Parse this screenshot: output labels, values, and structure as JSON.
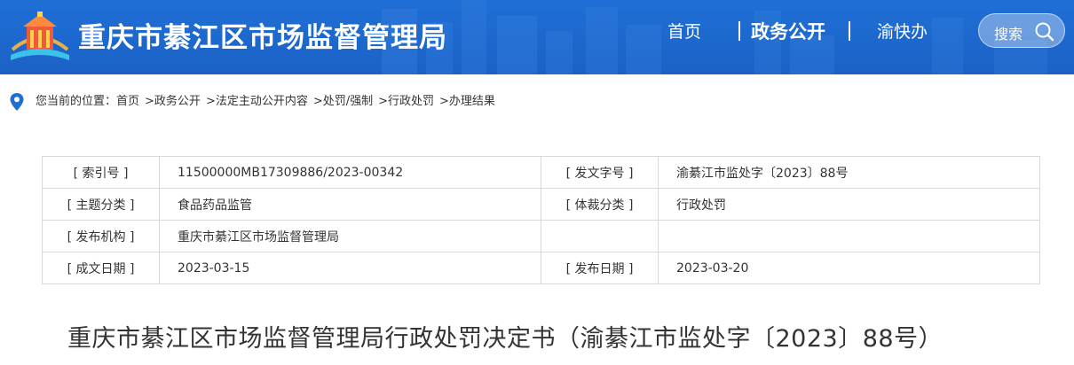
{
  "header": {
    "site_title": "重庆市綦江区市场监督管理局",
    "nav": {
      "home": "首页",
      "gov_open": "政务公开",
      "yukuaiban": "渝快办"
    },
    "search_label": "搜索",
    "colors": {
      "header_bg": "#1f6fd6"
    }
  },
  "breadcrumb": {
    "prefix": "您当前的位置：",
    "items": [
      "首页",
      ">政务公开",
      ">法定主动公开内容",
      ">处罚/强制",
      ">行政处罚",
      ">办理结果"
    ]
  },
  "meta": {
    "rows": [
      {
        "l1": "[ 索引号 ]",
        "v1": "11500000MB17309886/2023-00342",
        "l2": "[ 发文字号 ]",
        "v2": "渝綦江市监处字〔2023〕88号"
      },
      {
        "l1": "[ 主题分类 ]",
        "v1": "食品药品监管",
        "l2": "[ 体裁分类 ]",
        "v2": "行政处罚"
      },
      {
        "l1": "[ 发布机构 ]",
        "v1": "重庆市綦江区市场监督管理局",
        "l2": "",
        "v2": ""
      },
      {
        "l1": "[ 成文日期 ]",
        "v1": "2023-03-15",
        "l2": "[ 发布日期 ]",
        "v2": "2023-03-20"
      }
    ]
  },
  "doc": {
    "title": "重庆市綦江区市场监督管理局行政处罚决定书（渝綦江市监处字〔2023〕88号）"
  }
}
